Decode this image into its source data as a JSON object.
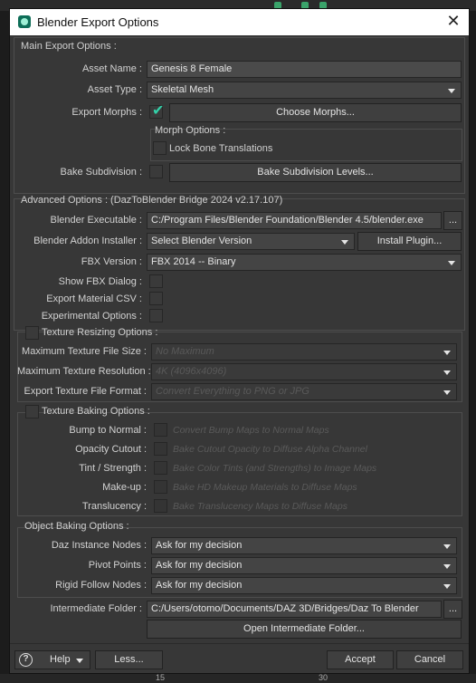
{
  "window": {
    "title": "Blender Export Options",
    "icon": "daz-bridge-app-icon",
    "close_glyph": "✕"
  },
  "main": {
    "title": "Main Export Options :",
    "asset_name_label": "Asset Name :",
    "asset_name_value": "Genesis 8 Female",
    "asset_type_label": "Asset Type :",
    "asset_type_value": "Skeletal Mesh",
    "export_morphs_label": "Export Morphs :",
    "export_morphs_checked": true,
    "choose_morphs_button": "Choose Morphs...",
    "morph_options_title": "Morph Options :",
    "lock_bone_label": "Lock Bone Translations",
    "bake_subdivision_label": "Bake Subdivision :",
    "bake_subdivision_button": "Bake Subdivision Levels..."
  },
  "advanced": {
    "title": "Advanced Options : (DazToBlender Bridge 2024 v2.17.107)",
    "blender_exe_label": "Blender Executable :",
    "blender_exe_value": "C:/Program Files/Blender Foundation/Blender 4.5/blender.exe",
    "browse_button": "...",
    "addon_installer_label": "Blender Addon Installer :",
    "addon_installer_value": "Select Blender Version",
    "install_plugin_button": "Install Plugin...",
    "fbx_version_label": "FBX Version :",
    "fbx_version_value": "FBX 2014 -- Binary",
    "show_fbx_label": "Show FBX Dialog :",
    "export_csv_label": "Export Material CSV :",
    "experimental_label": "Experimental Options :"
  },
  "texture_resizing": {
    "title": "Texture Resizing Options :",
    "max_file_size_label": "Maximum Texture File Size :",
    "max_file_size_value": "No Maximum",
    "max_resolution_label": "Maximum Texture Resolution :",
    "max_resolution_value": "4K (4096x4096)",
    "export_format_label": "Export Texture File Format :",
    "export_format_value": "Convert Everything to PNG or JPG"
  },
  "texture_baking": {
    "title": "Texture Baking Options :",
    "rows": [
      {
        "label": "Bump to Normal :",
        "desc": "Convert Bump Maps to Normal Maps"
      },
      {
        "label": "Opacity Cutout :",
        "desc": "Bake Cutout Opacity to Diffuse Alpha Channel"
      },
      {
        "label": "Tint / Strength :",
        "desc": "Bake Color Tints (and Strengths) to Image Maps"
      },
      {
        "label": "Make-up :",
        "desc": "Bake HD Makeup Materials to Diffuse Maps"
      },
      {
        "label": "Translucency :",
        "desc": "Bake Translucency Maps to Diffuse Maps"
      }
    ]
  },
  "object_baking": {
    "title": "Object Baking Options :",
    "instance_label": "Daz Instance Nodes :",
    "instance_value": "Ask for my decision",
    "pivot_label": "Pivot Points :",
    "pivot_value": "Ask for my decision",
    "rigid_label": "Rigid Follow Nodes :",
    "rigid_value": "Ask for my decision"
  },
  "intermediate": {
    "label": "Intermediate Folder :",
    "value": "C:/Users/otomo/Documents/DAZ 3D/Bridges/Daz To Blender",
    "browse_button": "...",
    "open_button": "Open Intermediate Folder..."
  },
  "footer": {
    "help_icon": "?",
    "help_button": "Help",
    "less_button": "Less...",
    "accept_button": "Accept",
    "cancel_button": "Cancel"
  },
  "background": {
    "ruler_left": "15",
    "ruler_right": "30"
  },
  "colors": {
    "window_bg": "#373737",
    "titlebar_bg": "#ffffff",
    "check_accent": "#33d0a8"
  }
}
